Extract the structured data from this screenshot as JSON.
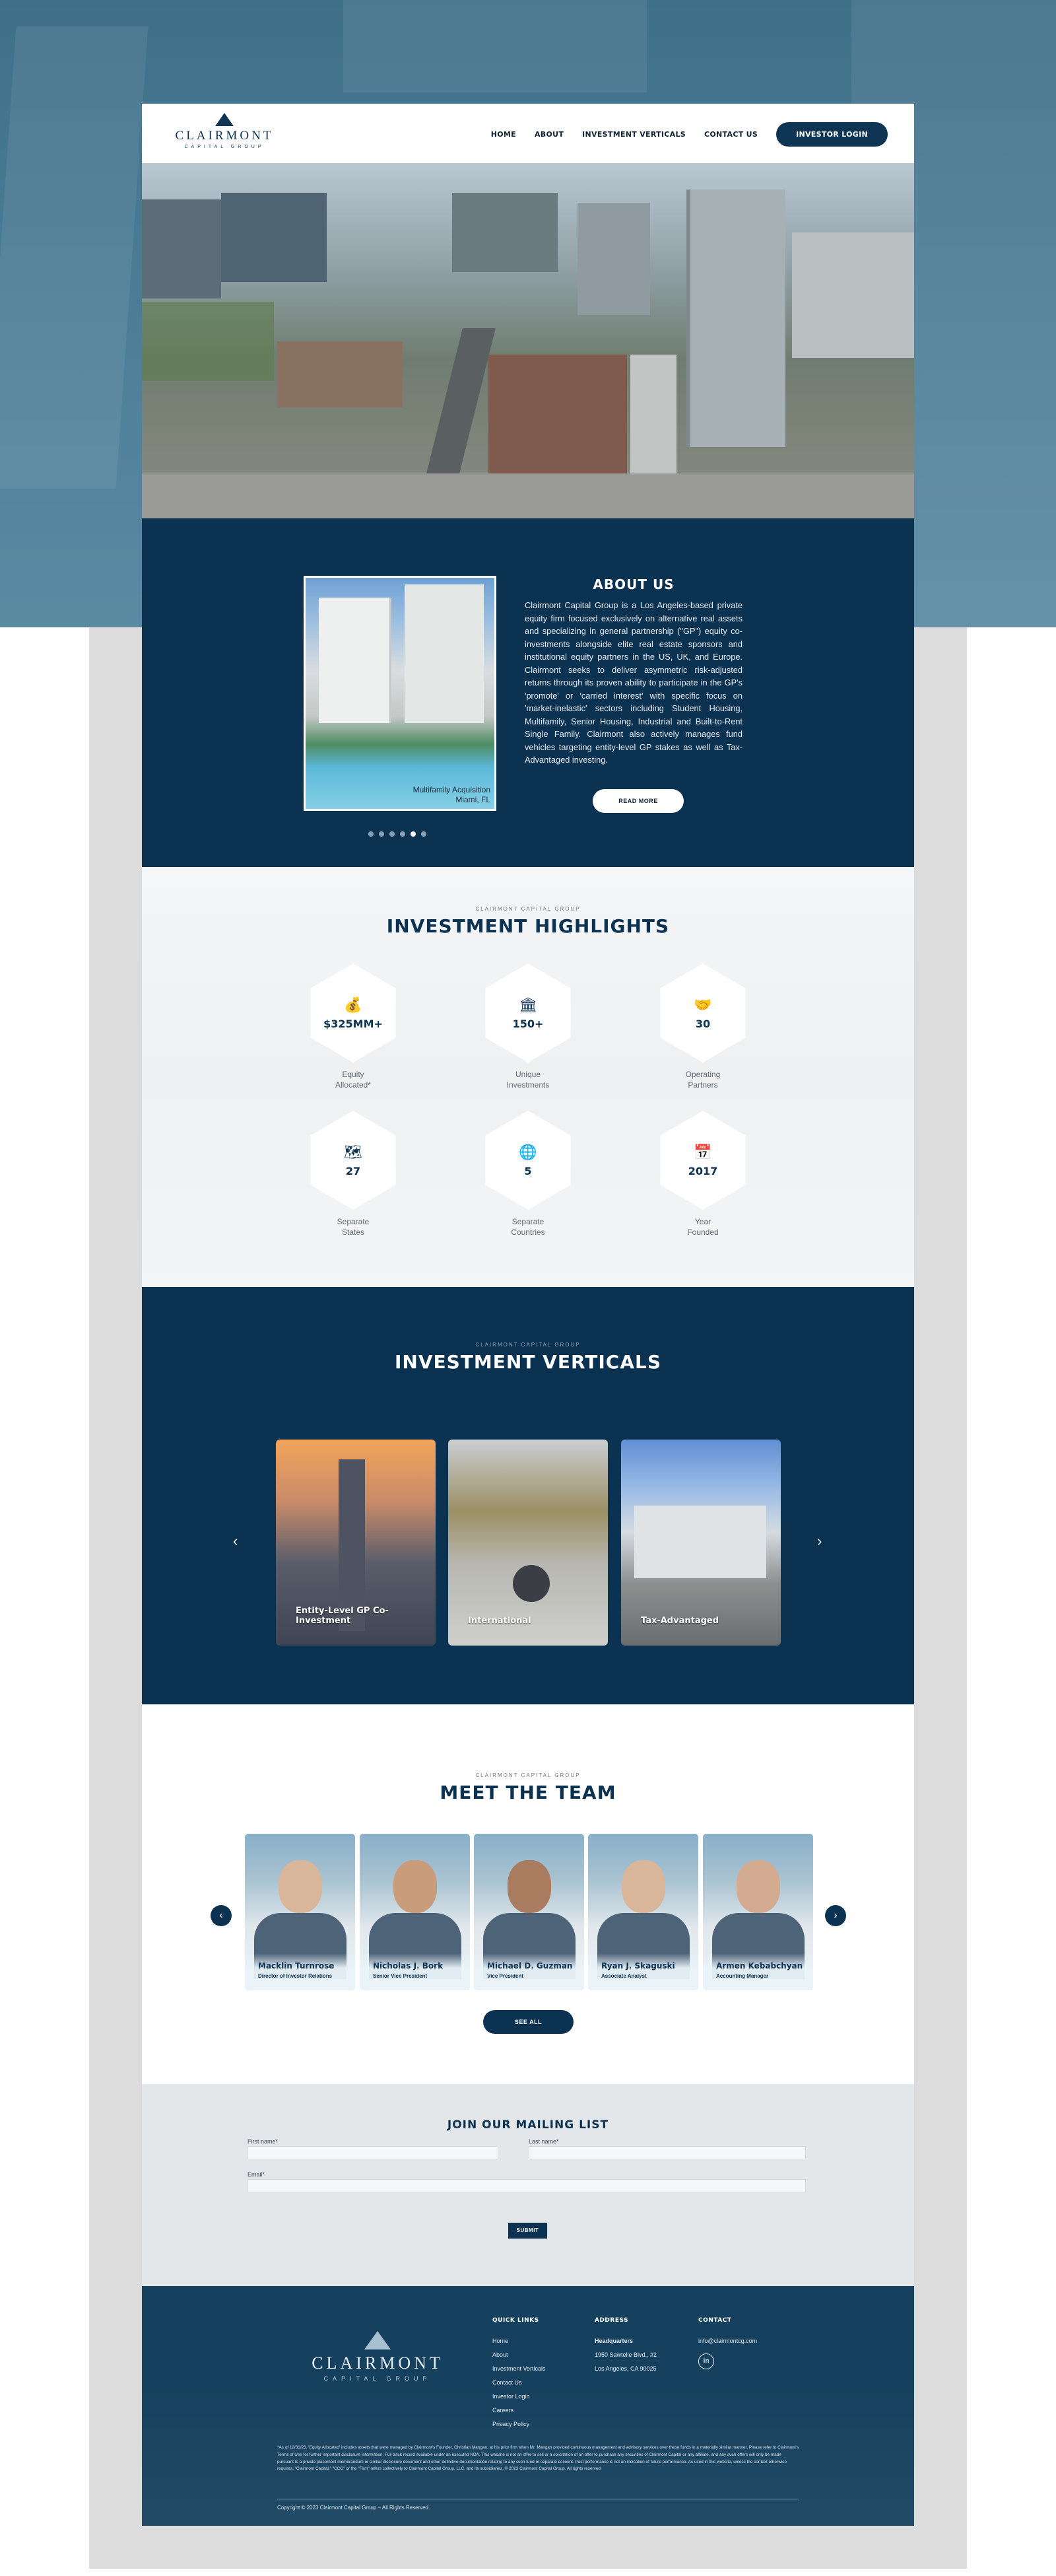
{
  "colors": {
    "navy": "#0c3252",
    "background_blue": "#4b7c96",
    "light_gray": "#e4e7ea",
    "white": "#ffffff"
  },
  "header": {
    "logo_name": "CLAIRMONT",
    "logo_sub": "CAPITAL GROUP",
    "nav": [
      {
        "label": "HOME"
      },
      {
        "label": "ABOUT"
      },
      {
        "label": "INVESTMENT VERTICALS"
      },
      {
        "label": "CONTACT US"
      }
    ],
    "login_label": "INVESTOR LOGIN"
  },
  "about": {
    "title": "ABOUT US",
    "body": "Clairmont Capital Group is a Los Angeles-based private equity firm focused exclusively on alternative real assets and specializing in general partnership (\"GP\") equity co-investments alongside elite real estate sponsors and institutional equity partners in the US, UK, and Europe. Clairmont seeks to deliver asymmetric risk-adjusted returns through its proven ability to participate in the GP's 'promote' or 'carried interest' with specific focus on 'market-inelastic' sectors including Student Housing, Multifamily, Senior Housing, Industrial and Built-to-Rent Single Family. Clairmont also actively manages fund vehicles targeting entity-level GP stakes as well as Tax-Advantaged investing.",
    "caption_line1": "Multifamily Acquisition",
    "caption_line2": "Miami, FL",
    "read_more_label": "READ MORE",
    "slides": 6,
    "active_slide": 5
  },
  "highlights": {
    "eyebrow": "CLAIRMONT CAPITAL GROUP",
    "title": "INVESTMENT HIGHLIGHTS",
    "items": [
      {
        "icon": "hand-coin-icon",
        "glyph": "💰",
        "value": "$325MM+",
        "label_line1": "Equity",
        "label_line2": "Allocated*"
      },
      {
        "icon": "building-icon",
        "glyph": "🏛",
        "value": "150+",
        "label_line1": "Unique",
        "label_line2": "Investments"
      },
      {
        "icon": "handshake-icon",
        "glyph": "🤝",
        "value": "30",
        "label_line1": "Operating",
        "label_line2": "Partners"
      },
      {
        "icon": "us-map-icon",
        "glyph": "🗺",
        "value": "27",
        "label_line1": "Separate",
        "label_line2": "States"
      },
      {
        "icon": "globe-icon",
        "glyph": "🌐",
        "value": "5",
        "label_line1": "Separate",
        "label_line2": "Countries"
      },
      {
        "icon": "calendar-icon",
        "glyph": "📅",
        "value": "2017",
        "label_line1": "Year",
        "label_line2": "Founded"
      }
    ]
  },
  "verticals": {
    "eyebrow": "CLAIRMONT CAPITAL GROUP",
    "title": "INVESTMENT VERTICALS",
    "cards": [
      {
        "label": "Entity-Level GP Co-Investment"
      },
      {
        "label": "International"
      },
      {
        "label": "Tax-Advantaged"
      }
    ]
  },
  "team": {
    "eyebrow": "CLAIRMONT CAPITAL GROUP",
    "title": "MEET THE TEAM",
    "members": [
      {
        "name": "Macklin Turnrose",
        "title": "Director of Investor Relations"
      },
      {
        "name": "Nicholas J. Bork",
        "title": "Senior Vice President"
      },
      {
        "name": "Michael D. Guzman",
        "title": "Vice President"
      },
      {
        "name": "Ryan J. Skaguski",
        "title": "Associate Analyst"
      },
      {
        "name": "Armen Kebabchyan",
        "title": "Accounting Manager"
      }
    ],
    "see_all_label": "SEE ALL"
  },
  "mailing": {
    "title": "JOIN OUR MAILING LIST",
    "first_name_label": "First name*",
    "last_name_label": "Last name*",
    "email_label": "Email*",
    "submit_label": "SUBMIT"
  },
  "footer": {
    "logo_name": "CLAIRMONT",
    "logo_sub": "CAPITAL GROUP",
    "quick_links_head": "QUICK LINKS",
    "quick_links": [
      "Home",
      "About",
      "Investment Verticals",
      "Contact Us",
      "Investor Login",
      "Careers",
      "Privacy Policy"
    ],
    "address_head": "ADDRESS",
    "address_lines": [
      "Headquarters",
      "1950 Sawtelle Blvd., #2",
      "Los Angeles, CA 90025"
    ],
    "contact_head": "CONTACT",
    "contact_email": "info@clairmontcg.com",
    "linkedin_label": "in",
    "disclaimer": "*As of 12/31/23. 'Equity Allocated' includes assets that were managed by Clairmont's Founder, Christian Mangan, at his prior firm when Mr. Mangan provided continuous management and advisory services over these funds in a materially similar manner. Please refer to Clairmont's Terms of Use for further important disclosure information. Full track record available under an executed NDA. This website is not an offer to sell or a solicitation of an offer to purchase any securities of Clairmont Capital or any affiliate, and any such offers will only be made pursuant to a private placement memorandum or similar disclosure document and other definitive documentation relating to any such fund or separate account. Past performance is not an indication of future performance. As used in this website, unless the context otherwise requires, \"Clairmont Capital,\" \"CCG\" or the \"Firm\" refers collectively to Clairmont Capital Group, LLC, and its subsidiaries. © 2023 Clairmont Capital Group. All rights reserved.",
    "copyright": "Copyright © 2023 Clairmont Capital Group – All Rights Reserved."
  }
}
